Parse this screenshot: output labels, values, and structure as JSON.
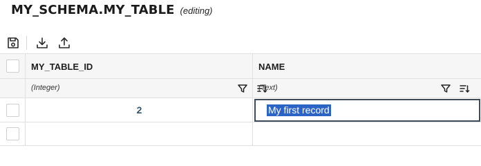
{
  "header": {
    "title": "MY_SCHEMA.MY_TABLE",
    "status": "(editing)"
  },
  "toolbar": {
    "icons": [
      "save-icon",
      "download-icon",
      "upload-icon"
    ]
  },
  "table": {
    "columns": [
      {
        "name": "MY_TABLE_ID",
        "type": "(Integer)"
      },
      {
        "name": "NAME",
        "type": "(Text)"
      }
    ],
    "rows": [
      {
        "my_table_id": "2",
        "name": "My first record"
      }
    ]
  },
  "colors": {
    "selection": "#2c64c6",
    "id_text": "#33546c",
    "editor_border": "#3c4a59",
    "header_bg": "#f6f6f6",
    "grid_line": "#e0e0e0"
  }
}
